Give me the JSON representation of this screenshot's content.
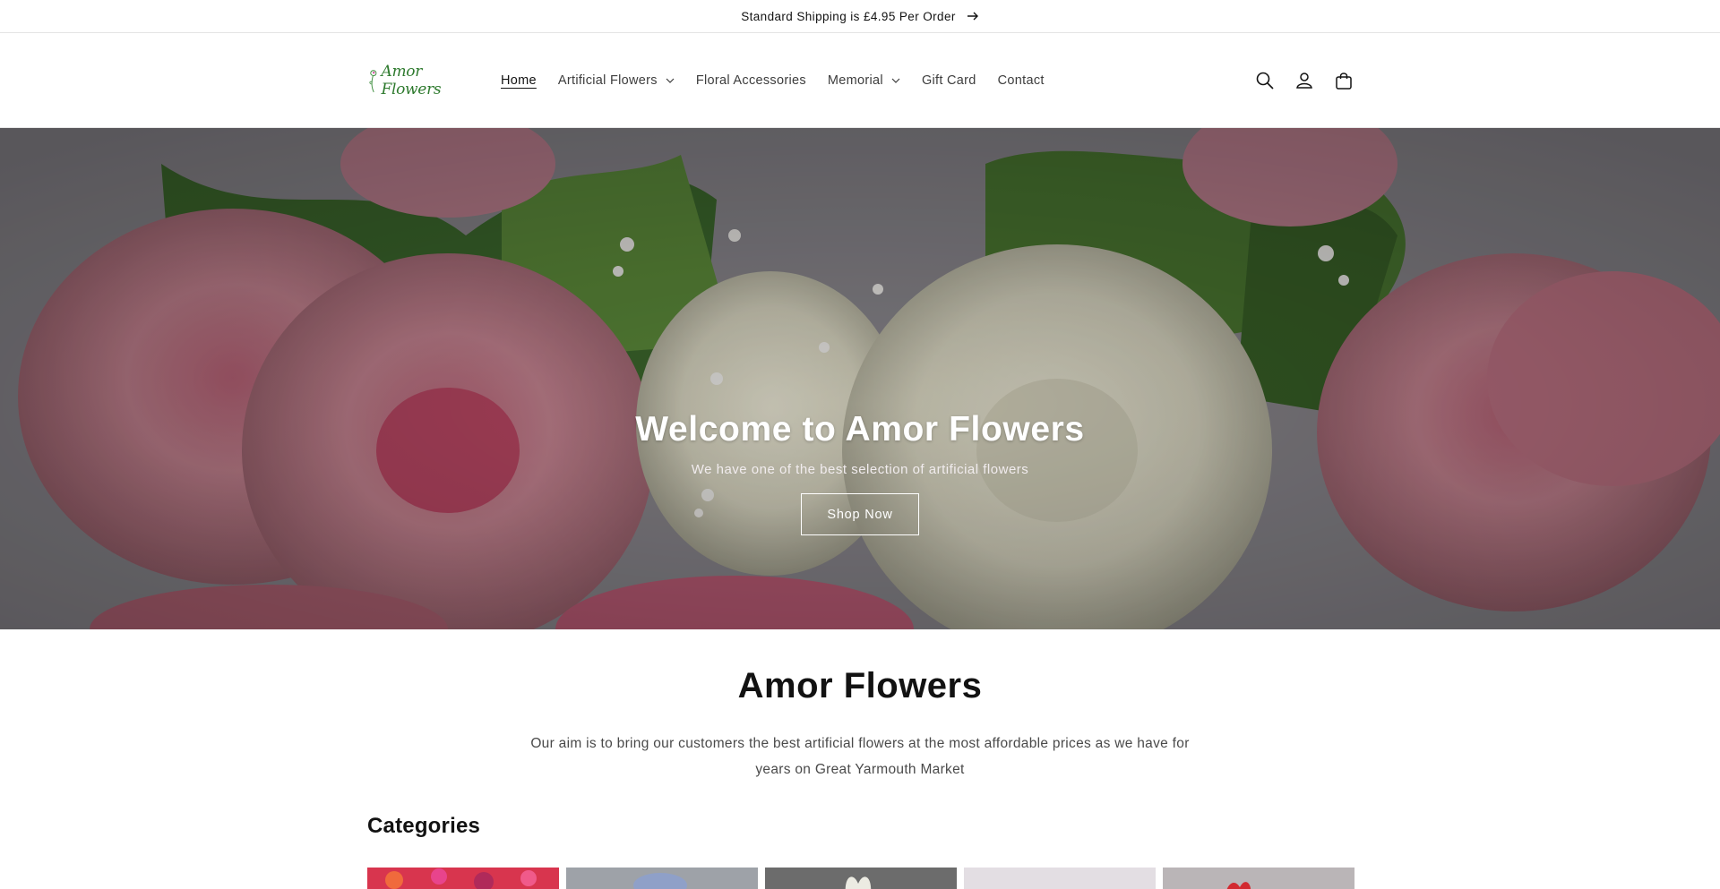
{
  "announcement": {
    "text": "Standard Shipping is £4.95 Per Order",
    "icon": "arrow-right-icon"
  },
  "header": {
    "logo_text": "Amor Flowers",
    "nav": [
      {
        "label": "Home",
        "active": true,
        "dropdown": false
      },
      {
        "label": "Artificial Flowers",
        "active": false,
        "dropdown": true
      },
      {
        "label": "Floral Accessories",
        "active": false,
        "dropdown": false
      },
      {
        "label": "Memorial",
        "active": false,
        "dropdown": true
      },
      {
        "label": "Gift Card",
        "active": false,
        "dropdown": false
      },
      {
        "label": "Contact",
        "active": false,
        "dropdown": false
      }
    ],
    "icons": [
      "search-icon",
      "account-icon",
      "cart-icon"
    ]
  },
  "hero": {
    "title": "Welcome to Amor Flowers",
    "subtitle": "We have one of the best selection of artificial flowers",
    "button_label": "Shop Now"
  },
  "about": {
    "title": "Amor Flowers",
    "text": "Our aim is to bring our customers the best artificial flowers at the most affordable prices as we have for years on Great Yarmouth Market"
  },
  "categories": {
    "heading": "Categories",
    "cards": [
      {
        "color": "#d8354e"
      },
      {
        "color": "#8fa0b8"
      },
      {
        "color": "#6a6a6a"
      },
      {
        "color": "#e6e2e6"
      },
      {
        "color": "#b8b3b5"
      }
    ]
  },
  "colors": {
    "logo_green": "#2e7a2e",
    "text": "#121212"
  }
}
